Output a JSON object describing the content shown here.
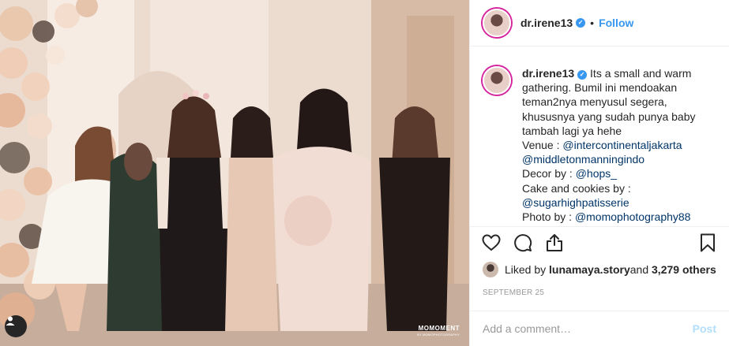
{
  "photo": {
    "watermark_main": "MOMOMENT",
    "watermark_sub": "BY MOMOPHOTOGRAPHY"
  },
  "header": {
    "username": "dr.irene13",
    "separator": "•",
    "follow_label": "Follow"
  },
  "caption": {
    "username": "dr.irene13",
    "lines": [
      "Its a small and warm",
      "gathering. Bumil ini mendoakan",
      "teman2nya menyusul segera,",
      "khususnya yang sudah punya baby",
      "tambah lagi ya hehe"
    ],
    "venue_label": "Venue : ",
    "venue_mention_1": "@intercontinentaljakarta",
    "venue_mention_2": "@middletonmanningindo",
    "decor_label": "Decor by : ",
    "decor_mention": "@hops_",
    "cake_label": "Cake and cookies by :",
    "cake_mention": "@sugarhighpatisserie",
    "photo_label": "Photo by : ",
    "photo_mention": "@momophotography88"
  },
  "likes": {
    "prefix": "Liked by ",
    "user": "lunamaya.story",
    "middle": " and ",
    "count": "3,279 others"
  },
  "date": "SEPTEMBER 25",
  "comment_box": {
    "placeholder": "Add a comment…",
    "post_label": "Post"
  },
  "colors": {
    "accent": "#3897f0",
    "mention": "#003569",
    "post_disabled": "#b2dffc"
  },
  "icons": [
    "heart-icon",
    "comment-icon",
    "share-icon",
    "bookmark-icon",
    "user-tag-icon",
    "verified-badge-icon"
  ]
}
